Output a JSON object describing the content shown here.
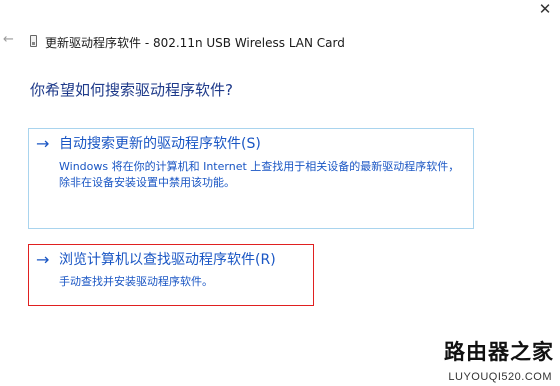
{
  "window": {
    "close_glyph": "✕",
    "back_glyph": "←",
    "device_icon": "usb-device-icon",
    "title": "更新驱动程序软件 - 802.11n USB Wireless LAN Card"
  },
  "question": "你希望如何搜索驱动程序软件?",
  "options": [
    {
      "arrow": "→",
      "title": "自动搜索更新的驱动程序软件(S)",
      "description": "Windows 将在你的计算机和 Internet 上查找用于相关设备的最新驱动程序软件，除非在设备安装设置中禁用该功能。"
    },
    {
      "arrow": "→",
      "title": "浏览计算机以查找驱动程序软件(R)",
      "description": "手动查找并安装驱动程序软件。"
    }
  ],
  "watermark": {
    "name": "路由器之家",
    "url": "LUYOUQI520.COM"
  },
  "colors": {
    "link": "#1a56c4",
    "heading": "#1e3a8a",
    "option_border": "#a9d4ee",
    "highlight": "#e02020"
  }
}
